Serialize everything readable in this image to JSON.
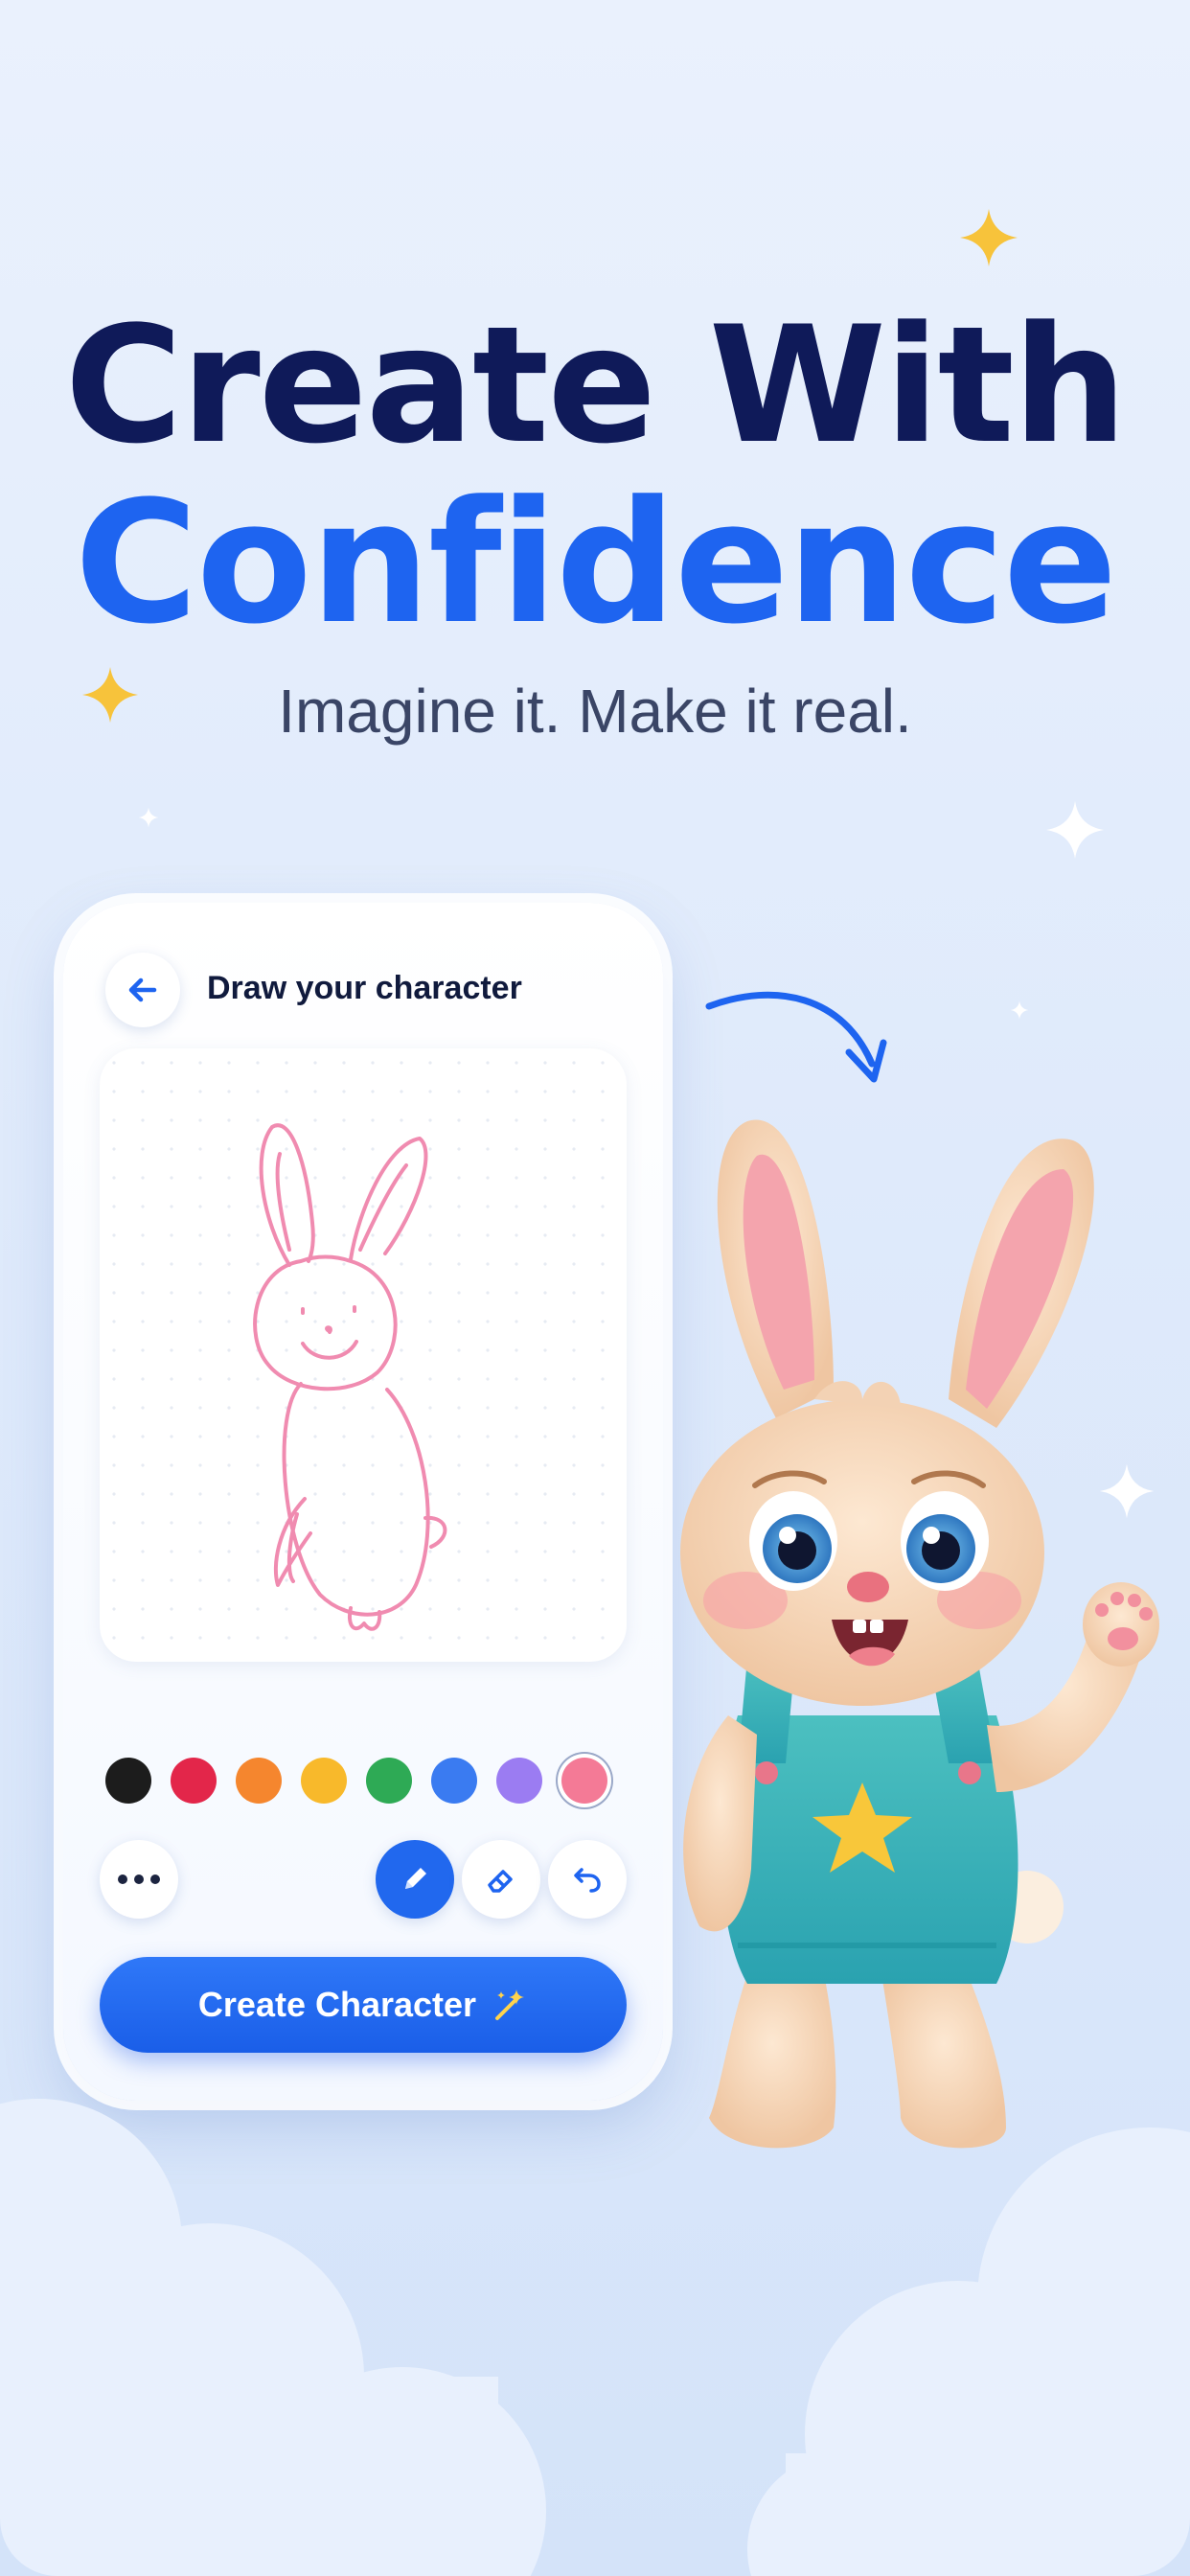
{
  "headline": {
    "line1": "Create With",
    "line2": "Confidence"
  },
  "tagline": "Imagine it. Make it real.",
  "phone": {
    "title": "Draw your character",
    "back_icon": "arrow-left-icon",
    "palette": {
      "colors": [
        "#1c1c1c",
        "#e3264a",
        "#f5862e",
        "#f8b92b",
        "#2eaa55",
        "#3a7bf1",
        "#9b7cf2",
        "#f47a96"
      ],
      "selected_index": 7
    },
    "tools": {
      "more_icon": "more-dots-icon",
      "pencil_icon": "pencil-icon",
      "eraser_icon": "eraser-icon",
      "undo_icon": "undo-icon"
    },
    "cta_label": "Create Character",
    "cta_icon": "magic-sparkles-icon",
    "drawing_color": "#f08bb0"
  },
  "colors": {
    "navy": "#0f1a59",
    "brand_blue": "#1e64f0",
    "background": "#e3ecfc"
  }
}
